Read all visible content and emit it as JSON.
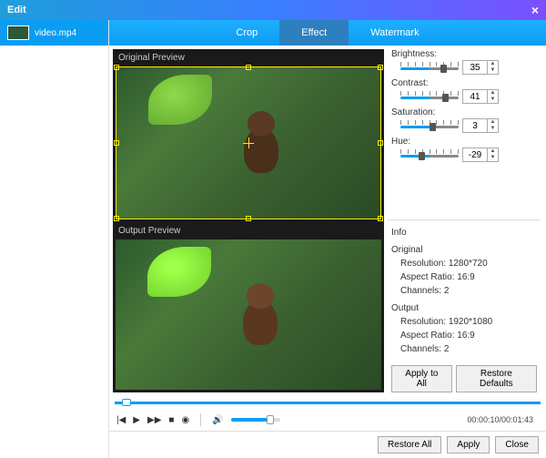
{
  "title": "Edit",
  "sidebar": {
    "file": {
      "name": "video.mp4"
    }
  },
  "tabs": {
    "crop": "Crop",
    "effect": "Effect",
    "watermark": "Watermark",
    "active": "effect"
  },
  "preview": {
    "original_label": "Original Preview",
    "output_label": "Output Preview"
  },
  "effects": {
    "brightness": {
      "label": "Brightness:",
      "value": "35"
    },
    "contrast": {
      "label": "Contrast:",
      "value": "41"
    },
    "saturation": {
      "label": "Saturation:",
      "value": "3"
    },
    "hue": {
      "label": "Hue:",
      "value": "-29"
    }
  },
  "info": {
    "heading": "Info",
    "original": {
      "label": "Original",
      "resolution_label": "Resolution:",
      "resolution": "1280*720",
      "aspect_label": "Aspect Ratio:",
      "aspect": "16:9",
      "channels_label": "Channels:",
      "channels": "2"
    },
    "output": {
      "label": "Output",
      "resolution_label": "Resolution:",
      "resolution": "1920*1080",
      "aspect_label": "Aspect Ratio:",
      "aspect": "16:9",
      "channels_label": "Channels:",
      "channels": "2"
    }
  },
  "buttons": {
    "apply_all": "Apply to All",
    "restore_defaults": "Restore Defaults",
    "restore_all": "Restore All",
    "apply": "Apply",
    "close": "Close"
  },
  "player": {
    "time": "00:00:10/00:01:43"
  }
}
